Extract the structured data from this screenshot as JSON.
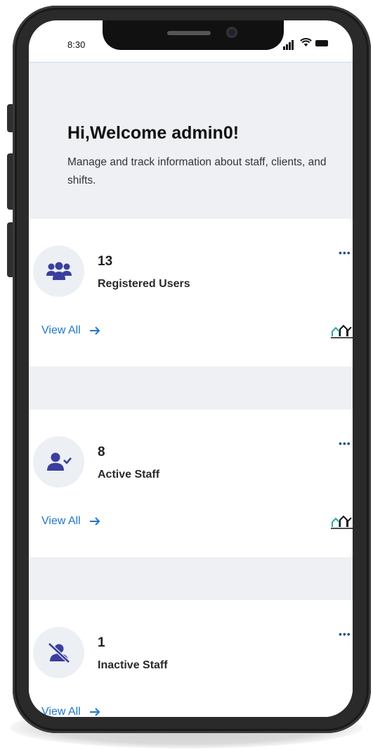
{
  "status": {
    "time": "8:30"
  },
  "greeting": {
    "title": "Hi,Welcome admin0!",
    "line1": "Manage and track information about staff, clients, and",
    "line2": "shifts."
  },
  "cards": [
    {
      "count": "13",
      "label": "Registered Users",
      "link": "View All",
      "icon": "users-group-icon"
    },
    {
      "count": "8",
      "label": "Active Staff",
      "link": "View All",
      "icon": "user-check-icon"
    },
    {
      "count": "1",
      "label": "Inactive Staff",
      "link": "View All",
      "icon": "user-slash-icon"
    }
  ],
  "colors": {
    "accent": "#2176c7",
    "icon": "#3a3f9e",
    "background": "#eef0f3"
  }
}
